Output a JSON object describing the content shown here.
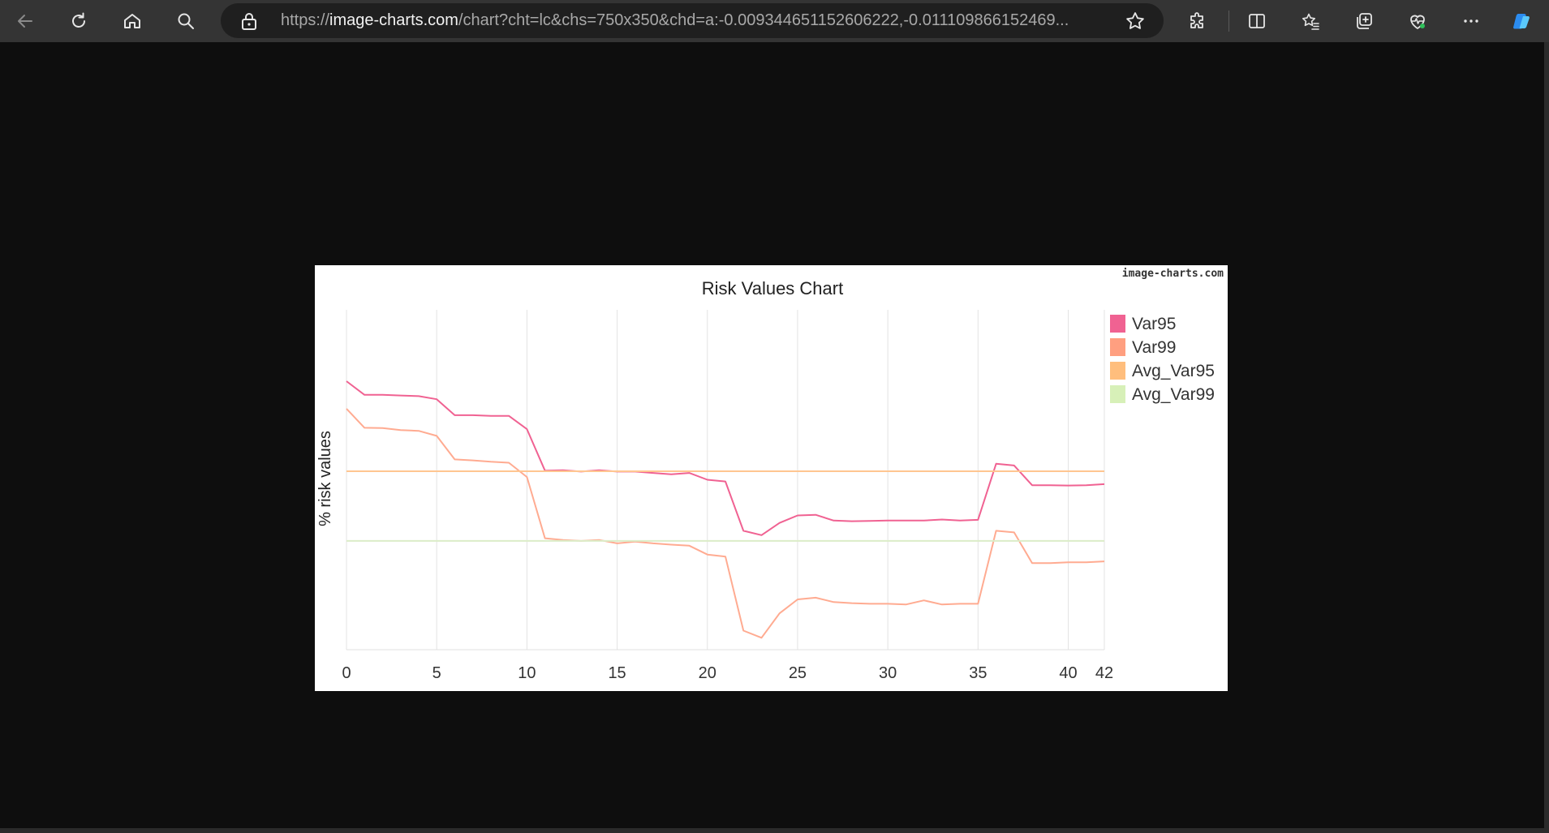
{
  "browser": {
    "url_prefix": "https://",
    "url_host": "image-charts.com",
    "url_rest": "/chart?cht=lc&chs=750x350&chd=a:-0.009344651152606222,-0.011109866152469...",
    "icons": {
      "back": "back-arrow-icon",
      "refresh": "refresh-icon",
      "home": "home-icon",
      "search": "search-icon",
      "lock": "lock-icon",
      "favorite": "star-icon",
      "extensions": "puzzle-icon",
      "split": "split-screen-icon",
      "favorites": "favorites-icon",
      "collections": "collections-icon",
      "health": "browser-essentials-icon",
      "more": "more-icon",
      "copilot": "copilot-icon"
    }
  },
  "chart_data": {
    "type": "line",
    "title": "Risk Values Chart",
    "ylabel": "% risk values",
    "xlabel": "",
    "watermark": "image-charts.com",
    "x": [
      0,
      1,
      2,
      3,
      4,
      5,
      6,
      7,
      8,
      9,
      10,
      11,
      12,
      13,
      14,
      15,
      16,
      17,
      18,
      19,
      20,
      21,
      22,
      23,
      24,
      25,
      26,
      27,
      28,
      29,
      30,
      31,
      32,
      33,
      34,
      35,
      36,
      37,
      38,
      39,
      40,
      41,
      42
    ],
    "xticks": [
      0,
      5,
      10,
      15,
      20,
      25,
      30,
      35,
      40,
      42
    ],
    "xlim": [
      0,
      42
    ],
    "ylim": [
      0,
      1
    ],
    "y_is_relative_scale": true,
    "grid": "vertical",
    "legend_position": "right",
    "series": [
      {
        "name": "Var95",
        "color": "#f06292",
        "legend_color": "#f06292",
        "values": [
          0.79,
          0.75,
          0.75,
          0.748,
          0.746,
          0.737,
          0.69,
          0.69,
          0.688,
          0.688,
          0.649,
          0.527,
          0.528,
          0.524,
          0.528,
          0.524,
          0.524,
          0.52,
          0.516,
          0.52,
          0.5,
          0.495,
          0.35,
          0.337,
          0.373,
          0.395,
          0.397,
          0.38,
          0.378,
          0.379,
          0.38,
          0.38,
          0.38,
          0.383,
          0.38,
          0.382,
          0.547,
          0.542,
          0.484,
          0.484,
          0.483,
          0.484,
          0.487
        ]
      },
      {
        "name": "Var99",
        "color": "#ffab91",
        "legend_color": "#ff9f80",
        "values": [
          0.709,
          0.653,
          0.652,
          0.646,
          0.644,
          0.629,
          0.56,
          0.557,
          0.553,
          0.55,
          0.508,
          0.328,
          0.323,
          0.32,
          0.323,
          0.313,
          0.318,
          0.313,
          0.309,
          0.306,
          0.28,
          0.274,
          0.056,
          0.035,
          0.107,
          0.148,
          0.153,
          0.14,
          0.137,
          0.135,
          0.135,
          0.133,
          0.145,
          0.133,
          0.135,
          0.135,
          0.35,
          0.345,
          0.255,
          0.255,
          0.257,
          0.257,
          0.26
        ]
      },
      {
        "name": "Avg_Var95",
        "color": "#ffc691",
        "legend_color": "#ffbe7d",
        "values": [
          0.525,
          0.525,
          0.525,
          0.525,
          0.525,
          0.525,
          0.525,
          0.525,
          0.525,
          0.525,
          0.525,
          0.525,
          0.525,
          0.525,
          0.525,
          0.525,
          0.525,
          0.525,
          0.525,
          0.525,
          0.525,
          0.525,
          0.525,
          0.525,
          0.525,
          0.525,
          0.525,
          0.525,
          0.525,
          0.525,
          0.525,
          0.525,
          0.525,
          0.525,
          0.525,
          0.525,
          0.525,
          0.525,
          0.525,
          0.525,
          0.525,
          0.525,
          0.525
        ]
      },
      {
        "name": "Avg_Var99",
        "color": "#dcedc8",
        "legend_color": "#d7f0b8",
        "values": [
          0.32,
          0.32,
          0.32,
          0.32,
          0.32,
          0.32,
          0.32,
          0.32,
          0.32,
          0.32,
          0.32,
          0.32,
          0.32,
          0.32,
          0.32,
          0.32,
          0.32,
          0.32,
          0.32,
          0.32,
          0.32,
          0.32,
          0.32,
          0.32,
          0.32,
          0.32,
          0.32,
          0.32,
          0.32,
          0.32,
          0.32,
          0.32,
          0.32,
          0.32,
          0.32,
          0.32,
          0.32,
          0.32,
          0.32,
          0.32,
          0.32,
          0.32,
          0.32
        ]
      }
    ]
  }
}
